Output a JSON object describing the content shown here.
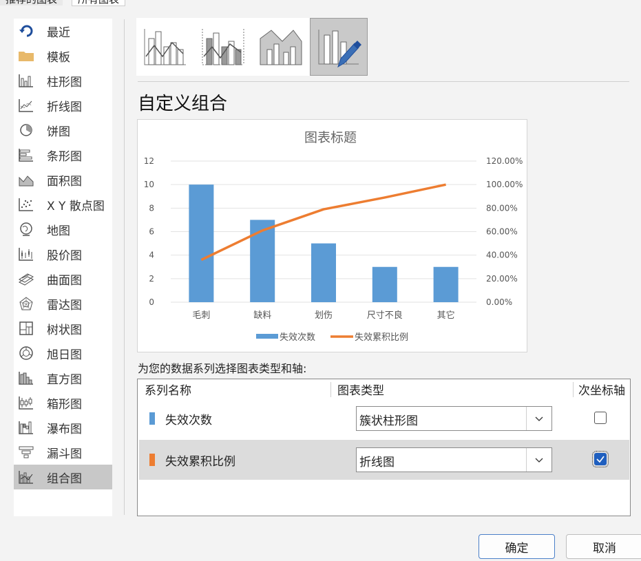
{
  "tabs": [
    "推荐的图表",
    "所有图表"
  ],
  "sidebar": {
    "items": [
      {
        "label": "最近",
        "icon": "recent-icon"
      },
      {
        "label": "模板",
        "icon": "folder-icon"
      },
      {
        "label": "柱形图",
        "icon": "column-chart-icon"
      },
      {
        "label": "折线图",
        "icon": "line-chart-icon"
      },
      {
        "label": "饼图",
        "icon": "pie-chart-icon"
      },
      {
        "label": "条形图",
        "icon": "bar-chart-icon"
      },
      {
        "label": "面积图",
        "icon": "area-chart-icon"
      },
      {
        "label": "X Y 散点图",
        "icon": "scatter-chart-icon"
      },
      {
        "label": "地图",
        "icon": "map-chart-icon"
      },
      {
        "label": "股价图",
        "icon": "stock-chart-icon"
      },
      {
        "label": "曲面图",
        "icon": "surface-chart-icon"
      },
      {
        "label": "雷达图",
        "icon": "radar-chart-icon"
      },
      {
        "label": "树状图",
        "icon": "treemap-chart-icon"
      },
      {
        "label": "旭日图",
        "icon": "sunburst-chart-icon"
      },
      {
        "label": "直方图",
        "icon": "histogram-chart-icon"
      },
      {
        "label": "箱形图",
        "icon": "box-whisker-chart-icon"
      },
      {
        "label": "瀑布图",
        "icon": "waterfall-chart-icon"
      },
      {
        "label": "漏斗图",
        "icon": "funnel-chart-icon"
      },
      {
        "label": "组合图",
        "icon": "combo-chart-icon"
      }
    ],
    "selected": "组合图"
  },
  "subtypes": [
    "clustered-column-line",
    "clustered-column-line-secondary-axis",
    "stacked-area-clustered-column",
    "custom-combination"
  ],
  "custom_title": "自定义组合",
  "chart_data": {
    "type": "bar",
    "title": "图表标题",
    "categories": [
      "毛刺",
      "缺料",
      "划伤",
      "尺寸不良",
      "其它"
    ],
    "series": [
      {
        "name": "失效次数",
        "type": "bar",
        "axis": "primary",
        "values": [
          10,
          7,
          5,
          3,
          3
        ],
        "color": "#5b9bd5"
      },
      {
        "name": "失效累积比例",
        "type": "line",
        "axis": "secondary",
        "values": [
          0.36,
          0.61,
          0.79,
          0.89,
          1.0
        ],
        "color": "#ed7d31"
      }
    ],
    "y_ticks": [
      "0",
      "2",
      "4",
      "6",
      "8",
      "10",
      "12"
    ],
    "y2_ticks": [
      "0.00%",
      "20.00%",
      "40.00%",
      "60.00%",
      "80.00%",
      "100.00%",
      "120.00%"
    ],
    "ylim": [
      0,
      12
    ],
    "y2lim": [
      0,
      1.2
    ],
    "grid": true,
    "legend": "bottom"
  },
  "instruction": "为您的数据系列选择图表类型和轴:",
  "table": {
    "headers": [
      "系列名称",
      "图表类型",
      "次坐标轴"
    ],
    "rows": [
      {
        "name": "失效次数",
        "chart_type": "簇状柱形图",
        "secondary_axis": false,
        "color": "#5b9bd5"
      },
      {
        "name": "失效累积比例",
        "chart_type": "折线图",
        "secondary_axis": true,
        "color": "#ed7d31"
      }
    ]
  },
  "buttons": {
    "ok": "确定",
    "cancel": "取消"
  }
}
